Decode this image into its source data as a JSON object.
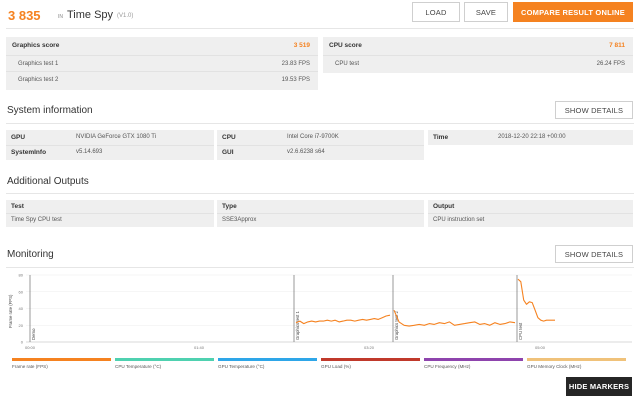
{
  "header": {
    "score": "3 835",
    "in_label": "IN",
    "test_name": "Time Spy",
    "version": "(V1.0)",
    "load_label": "LOAD",
    "save_label": "SAVE",
    "compare_label": "COMPARE RESULT ONLINE"
  },
  "graphics": {
    "title": "Graphics score",
    "score": "3 519",
    "tests": [
      {
        "name": "Graphics test 1",
        "value": "23.83 FPS"
      },
      {
        "name": "Graphics test 2",
        "value": "19.53 FPS"
      }
    ]
  },
  "cpu": {
    "title": "CPU score",
    "score": "7 811",
    "tests": [
      {
        "name": "CPU test",
        "value": "26.24 FPS"
      }
    ]
  },
  "system_info": {
    "title": "System information",
    "show_details": "SHOW DETAILS",
    "gpu_label": "GPU",
    "gpu_value": "NVIDIA GeForce GTX 1080 Ti",
    "systeminfo_label": "SystemInfo",
    "systeminfo_value": "v5.14.693",
    "cpu_label": "CPU",
    "cpu_value": "Intel Core i7-9700K",
    "gui_label": "GUI",
    "gui_value": "v2.6.6238 s64",
    "time_label": "Time",
    "time_value": "2018-12-20 22:18 +00:00"
  },
  "additional_outputs": {
    "title": "Additional Outputs",
    "col_test": "Test",
    "col_type": "Type",
    "col_output": "Output",
    "test_value": "Time Spy CPU test",
    "type_value": "SSE3Approx",
    "output_value": "CPU instruction set"
  },
  "monitoring": {
    "title": "Monitoring",
    "show_details": "SHOW DETAILS",
    "y_axis_label": "Frame rate (FPS)",
    "y_ticks": [
      "80",
      "60",
      "40",
      "20",
      "0"
    ],
    "x_ticks": [
      "00:00",
      "01:40",
      "03:20",
      "05:00"
    ],
    "markers": [
      "Demo",
      "Graphics test 1",
      "Graphics test 2",
      "CPU test"
    ],
    "legend": [
      {
        "label": "Frame rate (FPS)",
        "color": "#f58220"
      },
      {
        "label": "CPU Temperature (°C)",
        "color": "#4fd1b0"
      },
      {
        "label": "GPU Temperature (°C)",
        "color": "#2ea6e8"
      },
      {
        "label": "GPU Load (%)",
        "color": "#c0392b"
      },
      {
        "label": "CPU Frequency (MHz)",
        "color": "#8e44ad"
      },
      {
        "label": "GPU Memory Clock (MHz)",
        "color": "#f0c27a"
      }
    ],
    "hide_markers": "HIDE MARKERS"
  },
  "chart_data": {
    "type": "line",
    "ylabel": "Frame rate (FPS)",
    "ylim": [
      0,
      80
    ],
    "x_ticks": [
      "00:00",
      "01:40",
      "03:20",
      "05:00"
    ],
    "series": [
      {
        "name": "Frame rate (FPS)",
        "color": "#f58220",
        "segments": [
          {
            "marker": "Graphics test 1",
            "values": [
              23,
              25,
              22,
              24,
              25,
              24,
              25,
              25,
              26,
              25,
              26,
              24,
              25,
              26,
              26,
              25,
              26,
              27,
              26,
              27,
              28,
              27,
              29,
              31,
              32
            ]
          },
          {
            "marker": "Graphics test 2",
            "values": [
              38,
              24,
              20,
              19,
              20,
              21,
              20,
              22,
              21,
              23,
              22,
              24,
              20,
              21,
              22,
              23,
              24,
              21,
              22,
              20,
              23,
              21,
              22,
              24,
              23
            ]
          },
          {
            "marker": "CPU test",
            "values": [
              75,
              72,
              50,
              45,
              48,
              47,
              38,
              29,
              26,
              25,
              26,
              26,
              26,
              26
            ]
          }
        ]
      }
    ]
  }
}
